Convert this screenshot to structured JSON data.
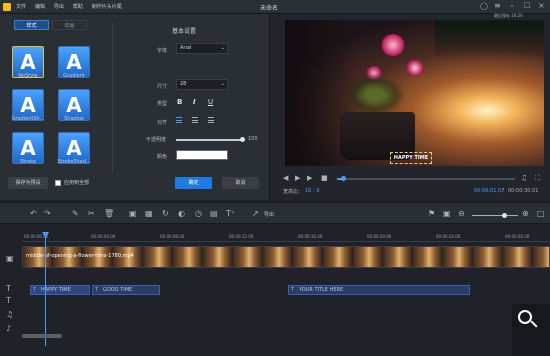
{
  "window": {
    "title": "未命名"
  },
  "menu": [
    "文件",
    "编辑",
    "导出",
    "帮助",
    "制作片头片尾"
  ],
  "status_top": "最后保存 16:26",
  "tabs": {
    "style": "样式",
    "animation": "动画"
  },
  "styles": [
    "NoStyle",
    "Gradient",
    "GradientSh...",
    "Shadow",
    "Stroke",
    "StrokeShad..."
  ],
  "basic": {
    "header": "基本设置",
    "font_label": "字体",
    "font_value": "Arial",
    "size_label": "尺寸",
    "size_value": "28",
    "type_label": "类型",
    "bold": "B",
    "italic": "I",
    "underline": "U",
    "align_label": "对齐",
    "opacity_label": "不透明度",
    "opacity_value": "100",
    "opacity_level": 100,
    "color_label": "颜色",
    "color_value": "#ffffff"
  },
  "buttons": {
    "save_preset": "保存为预设",
    "apply_all": "应用到全部",
    "ok": "确定",
    "cancel": "取消"
  },
  "preview": {
    "overlay_text": "HAPPY TIME",
    "ratio_label": "宽高比:",
    "ratio_value": "16 : 9",
    "time_current": "00:00:01.07",
    "time_total": "00:00:30.01",
    "progress": 0.035
  },
  "toolbar": {
    "export_label": "导出"
  },
  "timeline": {
    "ticks": [
      "00:00:00.00",
      "00:00:04.00",
      "00:00:08.00",
      "00:00:12.00",
      "00:00:16.00",
      "00:00:20.00",
      "00:00:24.00",
      "00:00:28.00"
    ],
    "video_clip": "middle-of-opening-a-flower-time-1780.mp4",
    "text_clips": [
      "HAPPY TIME",
      "GOOD TIME",
      "YOUR TITLE HERE"
    ]
  },
  "colors": {
    "accent": "#1e7be0",
    "tile": "#3a8ff0",
    "selected": "#e1c23a"
  }
}
